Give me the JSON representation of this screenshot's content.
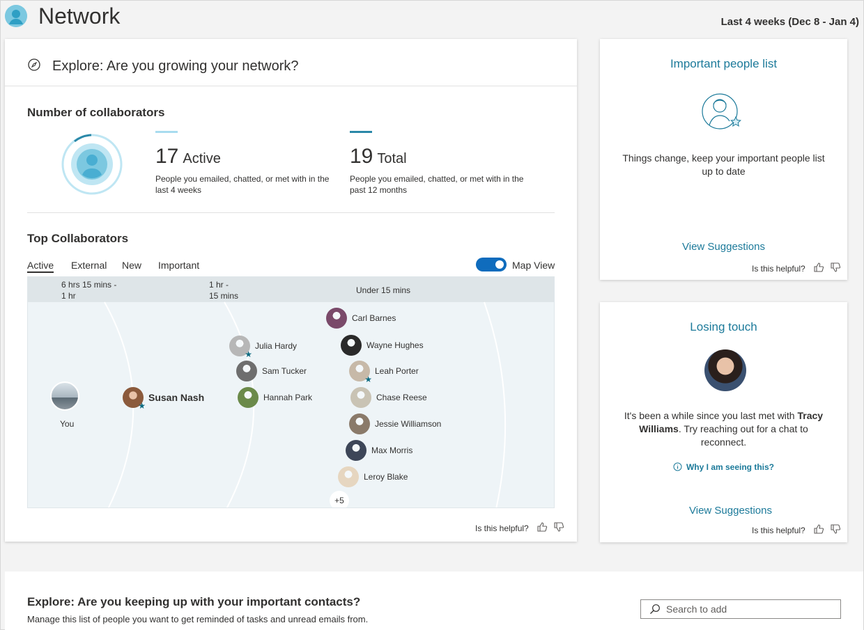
{
  "header": {
    "title": "Network",
    "date_range": "Last 4 weeks (Dec 8 - Jan 4)"
  },
  "explore": {
    "title": "Explore: Are you growing your network?"
  },
  "collaborators": {
    "section_title": "Number of collaborators",
    "active_count": "17",
    "active_label": "Active",
    "active_desc": "People you emailed, chatted, or met with in the last 4 weeks",
    "total_count": "19",
    "total_label": "Total",
    "total_desc": "People you emailed, chatted, or met with in the past 12 months"
  },
  "top_collaborators": {
    "section_title": "Top Collaborators",
    "tabs": [
      {
        "label": "Active",
        "active": true
      },
      {
        "label": "External",
        "active": false
      },
      {
        "label": "New",
        "active": false
      },
      {
        "label": "Important",
        "active": false
      }
    ],
    "map_view_label": "Map View",
    "map_view_on": true,
    "bands": [
      "6 hrs 15 mins -\n1 hr",
      "1 hr -\n15 mins",
      "Under 15 mins"
    ],
    "you_label": "You",
    "featured": {
      "name": "Susan Nash",
      "important": true,
      "color": "#8b5a3c"
    },
    "people": [
      {
        "name": "Julia Hardy",
        "important": true,
        "color": "#b7b7b7"
      },
      {
        "name": "Sam Tucker",
        "important": false,
        "color": "#6e6e6e"
      },
      {
        "name": "Hannah Park",
        "important": false,
        "color": "#6b8a4a"
      },
      {
        "name": "Carl Barnes",
        "important": false,
        "color": "#7a4a6a"
      },
      {
        "name": "Wayne Hughes",
        "important": false,
        "color": "#2a2a2a"
      },
      {
        "name": "Leah Porter",
        "important": true,
        "color": "#c7b9a8"
      },
      {
        "name": "Chase Reese",
        "important": false,
        "color": "#c9c3b4"
      },
      {
        "name": "Jessie Williamson",
        "important": false,
        "color": "#8a7a6a"
      },
      {
        "name": "Max Morris",
        "important": false,
        "color": "#3d4658"
      },
      {
        "name": "Leroy Blake",
        "important": false,
        "color": "#e6d6c0"
      }
    ],
    "more_count": "+5",
    "helpful_label": "Is this helpful?"
  },
  "important_people": {
    "title": "Important people list",
    "text": "Things change, keep your important people list up to date",
    "link": "View Suggestions",
    "helpful_label": "Is this helpful?"
  },
  "losing_touch": {
    "title": "Losing touch",
    "text_before": "It's been a while since you last met with",
    "person": "Tracy Williams",
    "text_after": ". Try reaching out for a chat to reconnect.",
    "why_link": "Why I am seeing this?",
    "link": "View Suggestions",
    "helpful_label": "Is this helpful?"
  },
  "important_contacts": {
    "title": "Explore: Are you keeping up with your important contacts?",
    "subtitle": "Manage this list of people you want to get reminded of tasks and unread emails from.",
    "search_placeholder": "Search to add"
  },
  "colors": {
    "accent_teal": "#1c7a9a",
    "toggle_blue": "#0f6cbd",
    "active_bar": "#a8dcef",
    "total_bar": "#2b88a8"
  }
}
